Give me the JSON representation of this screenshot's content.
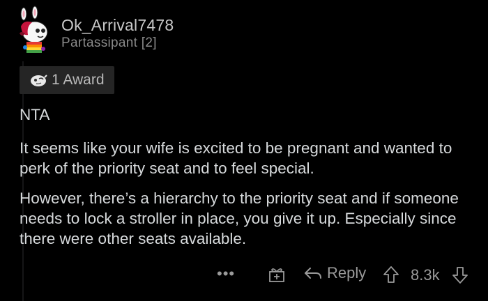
{
  "comment": {
    "author": {
      "username": "Ok_Arrival7478",
      "flair": "Partassipant [2]"
    },
    "award": {
      "label": "1 Award",
      "icon": "award-icon"
    },
    "paragraphs": [
      "NTA",
      "It seems like your wife is excited to be pregnant and wanted to perk of the priority seat and to feel special.",
      "However, there’s a hierarchy to the priority seat and if someone needs to lock a stroller in place, you give it up. Especially since there were other seats available."
    ],
    "actions": {
      "more": "•••",
      "reply_label": "Reply",
      "score": "8.3k"
    }
  },
  "colors": {
    "background": "#000000",
    "text": "#d7dadc",
    "muted": "#9a9a9a",
    "award_bg": "#252525"
  }
}
